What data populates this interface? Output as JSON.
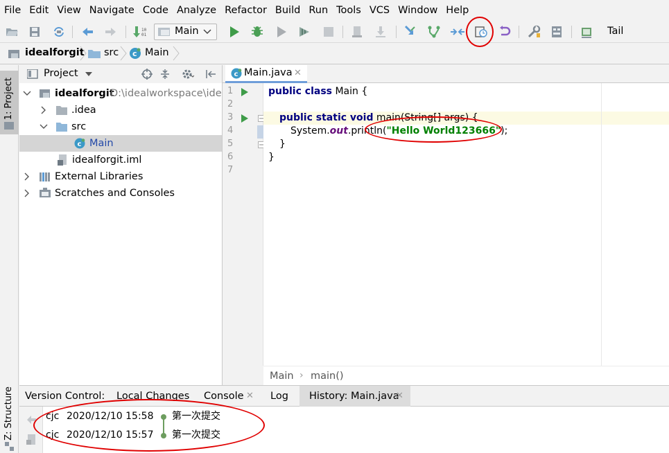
{
  "menu": [
    "File",
    "Edit",
    "View",
    "Navigate",
    "Code",
    "Analyze",
    "Refactor",
    "Build",
    "Run",
    "Tools",
    "VCS",
    "Window",
    "Help"
  ],
  "toolbar": {
    "run_config": "Main",
    "tail_label": "Tail"
  },
  "navbar": {
    "crumbs": [
      "idealforgit",
      "src",
      "Main"
    ]
  },
  "left_strip": {
    "project_label": "1: Project",
    "structure_label": "Z: Structure"
  },
  "project_panel": {
    "header": "Project",
    "tree": {
      "root_name": "idealforgit",
      "root_path": "D:\\idealworkspace\\idealforgit",
      "idea": ".idea",
      "src": "src",
      "main": "Main",
      "iml": "idealforgit.iml",
      "ext_libs": "External Libraries",
      "scratches": "Scratches and Consoles"
    }
  },
  "editor": {
    "tab": "Main.java",
    "line_numbers": [
      "1",
      "2",
      "3",
      "4",
      "5",
      "6",
      "7"
    ],
    "code": {
      "l1_kw": "public class",
      "l1_rest": " Main {",
      "l3_kw": "public static void",
      "l3_rest": " main(String[] args) {",
      "l4_a": "System.",
      "l4_field": "out",
      "l4_b": ".println(",
      "l4_str": "\"Hello World123666\"",
      "l4_c": ");",
      "l5": "}",
      "l6": "}"
    },
    "breadcrumb": [
      "Main",
      "main()"
    ]
  },
  "bottom": {
    "tabs": [
      "Version Control:",
      "Local Changes",
      "Console",
      "Log",
      "History: Main.java"
    ],
    "history": [
      {
        "author": "cjc",
        "date": "2020/12/10 15:58",
        "message": "第一次提交"
      },
      {
        "author": "cjc",
        "date": "2020/12/10 15:57",
        "message": "第一次提交"
      }
    ]
  },
  "colors": {
    "keyword": "#000080",
    "string": "#008000",
    "field": "#660e7a",
    "annotation": "#e00000",
    "selection": "#d5d5d5",
    "accent": "#6e9dd9"
  }
}
